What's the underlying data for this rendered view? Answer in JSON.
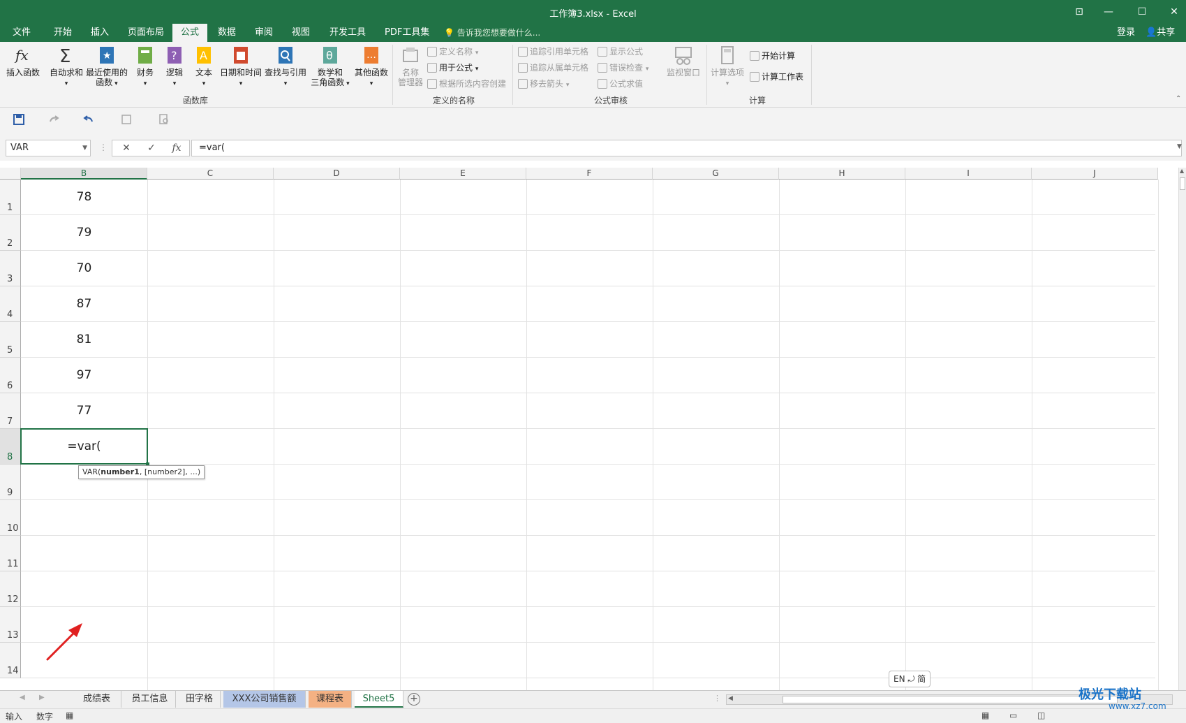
{
  "window": {
    "title": "工作簿3.xlsx - Excel",
    "controls": [
      "ribbon-display",
      "minimize",
      "maximize",
      "close"
    ]
  },
  "menu": {
    "tabs": [
      "文件",
      "开始",
      "插入",
      "页面布局",
      "公式",
      "数据",
      "审阅",
      "视图",
      "开发工具",
      "PDF工具集"
    ],
    "active_tab": "公式",
    "tell_me": "告诉我您想要做什么...",
    "login": "登录",
    "share": "共享"
  },
  "ribbon": {
    "function_library": {
      "label": "函数库",
      "insert_function": "插入函数",
      "autosum": "自动求和",
      "recent_line1": "最近使用的",
      "recent_line2": "函数",
      "financial": "财务",
      "logical": "逻辑",
      "text": "文本",
      "date_time": "日期和时间",
      "lookup": "查找与引用",
      "math_line1": "数学和",
      "math_line2": "三角函数",
      "more": "其他函数"
    },
    "defined_names": {
      "label": "定义的名称",
      "name_manager_line1": "名称",
      "name_manager_line2": "管理器",
      "define_name": "定义名称",
      "use_in_formula": "用于公式",
      "create_from_selection": "根据所选内容创建"
    },
    "formula_auditing": {
      "label": "公式审核",
      "trace_precedents": "追踪引用单元格",
      "trace_dependents": "追踪从属单元格",
      "remove_arrows": "移去箭头",
      "show_formulas": "显示公式",
      "error_checking": "错误检查",
      "evaluate_formula": "公式求值",
      "watch_window": "监视窗口"
    },
    "calculation": {
      "label": "计算",
      "options": "计算选项",
      "calc_now": "开始计算",
      "calc_sheet": "计算工作表"
    }
  },
  "formula_bar": {
    "name_box": "VAR",
    "cancel": "✕",
    "enter": "✓",
    "fx": "fx",
    "content": "=var("
  },
  "grid": {
    "columns": [
      "B",
      "C",
      "D",
      "E",
      "F",
      "G",
      "H",
      "I",
      "J"
    ],
    "selected_column": "B",
    "rows": [
      "1",
      "2",
      "3",
      "4",
      "5",
      "6",
      "7",
      "8",
      "9",
      "10",
      "11",
      "12",
      "13",
      "14"
    ],
    "selected_row": "8",
    "cells_b": [
      "78",
      "79",
      "70",
      "87",
      "81",
      "97",
      "77"
    ],
    "active_cell_text": "=var(",
    "tooltip": {
      "func": "VAR(",
      "arg1": "number1",
      "rest": ", [number2], ...)"
    }
  },
  "ime": "EN ⤾ 简",
  "sheets": [
    {
      "name": "成绩表",
      "style": "normal"
    },
    {
      "name": "员工信息",
      "style": "normal"
    },
    {
      "name": "田字格",
      "style": "normal"
    },
    {
      "name": "XXX公司销售额",
      "style": "blue"
    },
    {
      "name": "课程表",
      "style": "orange"
    },
    {
      "name": "Sheet5",
      "style": "active"
    }
  ],
  "status": {
    "mode": "输入",
    "numlock": "数字"
  },
  "watermark": {
    "line1": "极光下载站",
    "line2": "www.xz7.com"
  },
  "colors": {
    "brand": "#217346",
    "annotation_arrow": "#e02020"
  }
}
